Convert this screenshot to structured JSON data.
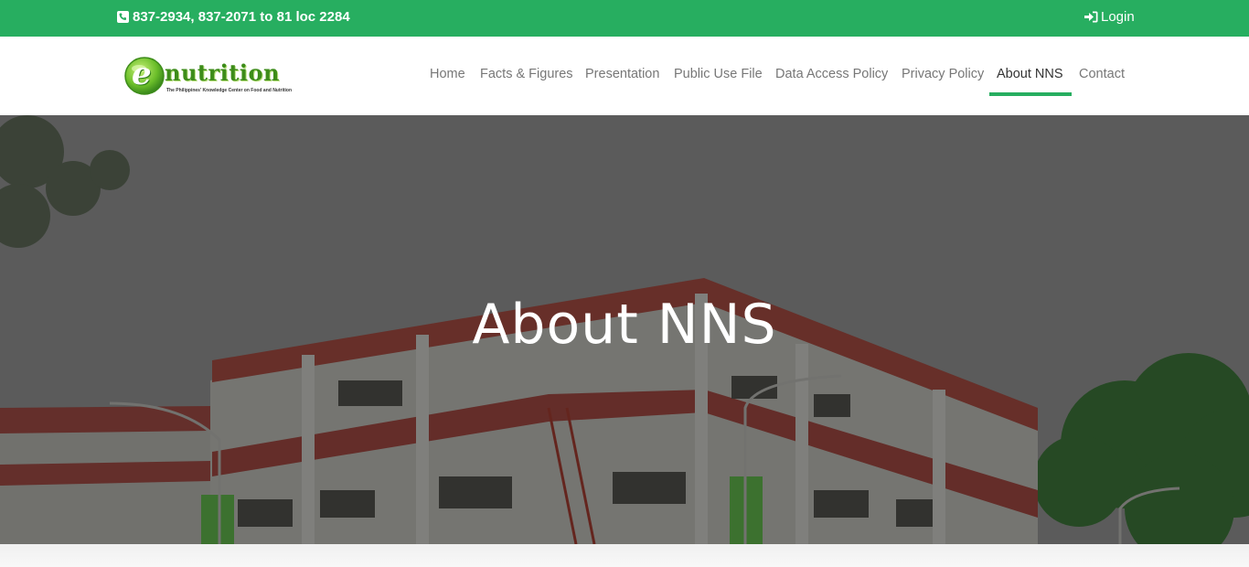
{
  "topbar": {
    "phone_icon": "phone-icon",
    "phone_text": "837-2934, 837-2071 to 81 loc 2284",
    "login_icon": "sign-in-icon",
    "login_label": "Login",
    "bg_color": "#27ae60"
  },
  "logo": {
    "brand": "nutrition",
    "letter": "e",
    "tagline": "The Philippines' Knowledge Center on Food and Nutrition"
  },
  "nav": {
    "items": [
      {
        "label": "Home"
      },
      {
        "label": "Facts & Figures"
      },
      {
        "label": "Presentation"
      },
      {
        "label": "Public Use File"
      },
      {
        "label": "Data Access Policy"
      },
      {
        "label": "Privacy Policy"
      },
      {
        "label": "About NNS",
        "active": true
      },
      {
        "label": "Contact"
      }
    ],
    "accent_color": "#27ae60"
  },
  "hero": {
    "title": "About NNS"
  }
}
